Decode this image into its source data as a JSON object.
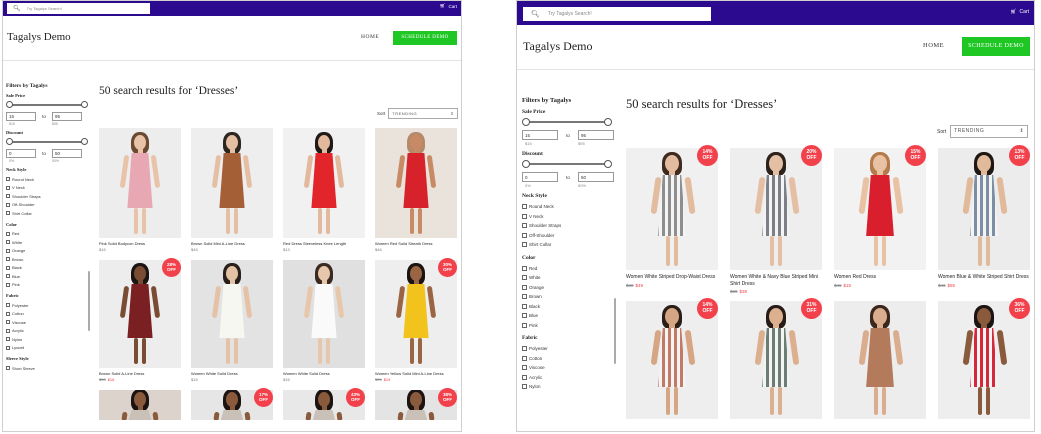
{
  "colors": {
    "topbar": "#2b0a8f",
    "accent_green": "#1ec724",
    "badge_red": "#f2414b"
  },
  "left": {
    "search_placeholder": "Try Tagalys Search!",
    "cart": "Cart",
    "brand": "Tagalys Demo",
    "nav_home": "HOME",
    "demo_button": "SCHEDULE DEMO",
    "filters_title": "Filters by Tagalys",
    "sale_price": {
      "title": "Sale Price",
      "min": "15",
      "to": "to",
      "max": "95",
      "label_min": "$15",
      "label_max": "$95"
    },
    "discount": {
      "title": "Discount",
      "min": "0",
      "to": "to",
      "max": "50",
      "label_min": "0%",
      "label_max": "50%"
    },
    "neck_style": {
      "title": "Neck Style",
      "options": [
        "Round Neck",
        "V Neck",
        "Shoulder Straps",
        "Off-Shoulder",
        "Shirt Collar"
      ]
    },
    "color": {
      "title": "Color",
      "options": [
        "Red",
        "White",
        "Orange",
        "Brown",
        "Black",
        "Blue",
        "Pink"
      ]
    },
    "fabric": {
      "title": "Fabric",
      "options": [
        "Polyester",
        "Cotton",
        "Viscose",
        "Acrylic",
        "Nylon",
        "Lyocell"
      ]
    },
    "sleeve_style": {
      "title": "Sleeve Style",
      "options": [
        "Short Sleeve"
      ]
    },
    "results_title": "50 search results for ‘Dresses’",
    "sort_label": "Sort",
    "sort_value": "TRENDING",
    "products": [
      {
        "name": "Pink Solid Bodycon Dress",
        "old": "",
        "price": "$16",
        "badge1": "",
        "badge2": "",
        "dress": "#e7a7b3",
        "bg": "#ededed",
        "skin": "#e8c3a8",
        "hair": "#6b4a32",
        "legs": "#e8c3a8"
      },
      {
        "name": "Brown Solid Mini A-Line Dress",
        "old": "",
        "price": "$45",
        "badge1": "",
        "badge2": "",
        "dress": "#a45f37",
        "bg": "#eeeeee",
        "skin": "#e5bfa4",
        "hair": "#2d2520",
        "legs": "#e5bfa4"
      },
      {
        "name": "Red Dress Sleeveless Knee Length",
        "old": "",
        "price": "$13",
        "badge1": "",
        "badge2": "",
        "dress": "#e1252a",
        "bg": "#f1f1f1",
        "skin": "#e2b99d",
        "hair": "#1f1a18",
        "legs": "#e2b99d"
      },
      {
        "name": "Women Red Solid Sheath Dress",
        "old": "",
        "price": "$46",
        "badge1": "",
        "badge2": "",
        "dress": "#d8222b",
        "bg": "#e9e3dc",
        "skin": "#c88a64",
        "hair": "#b58a6a",
        "legs": "#c88a64"
      },
      {
        "name": "Brown Solid A-Line Dress",
        "old": "$28",
        "price": "$16",
        "badge1": "28%",
        "badge2": "OFF",
        "dress": "#7a1f22",
        "bg": "#ededed",
        "skin": "#7a4c33",
        "hair": "#1c1412",
        "legs": "#7a4c33"
      },
      {
        "name": "Women White Solid Dress",
        "old": "",
        "price": "$15",
        "badge1": "",
        "badge2": "",
        "dress": "#f7f7f2",
        "bg": "#e3e3e3",
        "skin": "#e5c2a6",
        "hair": "#2a201b",
        "legs": "#e5c2a6"
      },
      {
        "name": "Women White Solid Dress",
        "old": "",
        "price": "$16",
        "badge1": "",
        "badge2": "",
        "dress": "#fafafa",
        "bg": "#e0e0e0",
        "skin": "#e7c7ab",
        "hair": "#3a2b22",
        "legs": "#e7c7ab"
      },
      {
        "name": "Women Yellow Solid Mini A-Line Dress",
        "old": "$25",
        "price": "$19",
        "badge1": "30%",
        "badge2": "OFF",
        "dress": "#f2c21d",
        "bg": "#eeeeee",
        "skin": "#9a6542",
        "hair": "#1a1413",
        "legs": "#9a6542"
      }
    ],
    "row3_badges": [
      {
        "b1": "",
        "b2": ""
      },
      {
        "b1": "17%",
        "b2": "OFF"
      },
      {
        "b1": "43%",
        "b2": "OFF"
      },
      {
        "b1": "38%",
        "b2": "OFF"
      }
    ]
  },
  "right": {
    "search_placeholder": "Try Tagalys Search!",
    "cart": "Cart",
    "brand": "Tagalys Demo",
    "nav_home": "HOME",
    "demo_button": "SCHEDULE DEMO",
    "filters_title": "Filters by Tagalys",
    "sale_price": {
      "title": "Sale Price",
      "min": "15",
      "to": "to",
      "max": "95",
      "label_min": "$15",
      "label_max": "$95"
    },
    "discount": {
      "title": "Discount",
      "min": "0",
      "to": "to",
      "max": "50",
      "label_min": "0%",
      "label_max": "50%"
    },
    "neck_style": {
      "title": "Neck Style",
      "options": [
        "Round Neck",
        "V Neck",
        "Shoulder Straps",
        "Off-Shoulder",
        "Shirt Collar"
      ]
    },
    "color": {
      "title": "Color",
      "options": [
        "Red",
        "White",
        "Orange",
        "Brown",
        "Black",
        "Blue",
        "Pink"
      ]
    },
    "fabric": {
      "title": "Fabric",
      "options": [
        "Polyester",
        "Cotton",
        "Viscose",
        "Acrylic",
        "Nylon"
      ]
    },
    "results_title": "50 search results for ‘Dresses’",
    "sort_label": "Sort",
    "sort_value": "TRENDING",
    "products": [
      {
        "name": "Women White Striped Drop-Waist Dress",
        "old": "$38",
        "price": "$49",
        "badge1": "14%",
        "badge2": "OFF",
        "dress": "#8e8e8e",
        "bg": "#f0f0f0",
        "skin": "#e3bb9f",
        "hair": "#3e2a1f",
        "legs": "#e3bb9f",
        "stripe": true
      },
      {
        "name": "Women White & Navy Blue Striped Mini Shirt Dress",
        "old": "$30",
        "price": "$39",
        "badge1": "20%",
        "badge2": "OFF",
        "dress": "#7d7f87",
        "bg": "#eeeeee",
        "skin": "#e4bfa3",
        "hair": "#2c211b",
        "legs": "#e4bfa3",
        "stripe": true
      },
      {
        "name": "Women Red Dress",
        "old": "$46",
        "price": "$15",
        "badge1": "15%",
        "badge2": "OFF",
        "dress": "#d91f2e",
        "bg": "#f2f2f2",
        "skin": "#e8c2a2",
        "hair": "#b47a4b",
        "legs": "#e8c2a2"
      },
      {
        "name": "Women Blue & White Striped Shirt Dress",
        "old": "$43",
        "price": "$55",
        "badge1": "13%",
        "badge2": "OFF",
        "dress": "#7c8ea3",
        "bg": "#ececec",
        "skin": "#e1b99b",
        "hair": "#1f1714",
        "legs": "#e1b99b",
        "stripe": true
      }
    ],
    "row2": [
      {
        "badge1": "14%",
        "badge2": "OFF",
        "dress": "#c07a66",
        "bg": "#eeeeee",
        "skin": "#d6a684",
        "hair": "#2a1e18",
        "stripe": true
      },
      {
        "badge1": "31%",
        "badge2": "OFF",
        "dress": "#6c7d75",
        "bg": "#eeeeee",
        "skin": "#dcb08f",
        "hair": "#261b16",
        "stripe": true
      },
      {
        "badge1": "",
        "badge2": "",
        "dress": "#b47a5c",
        "bg": "#ededed",
        "skin": "#d9ad8d",
        "hair": "#3a271d",
        "stripe": false
      },
      {
        "badge1": "36%",
        "badge2": "OFF",
        "dress": "#d6283b",
        "bg": "#eeeeee",
        "skin": "#8a5a3c",
        "hair": "#1c1412",
        "stripe": true
      }
    ]
  }
}
